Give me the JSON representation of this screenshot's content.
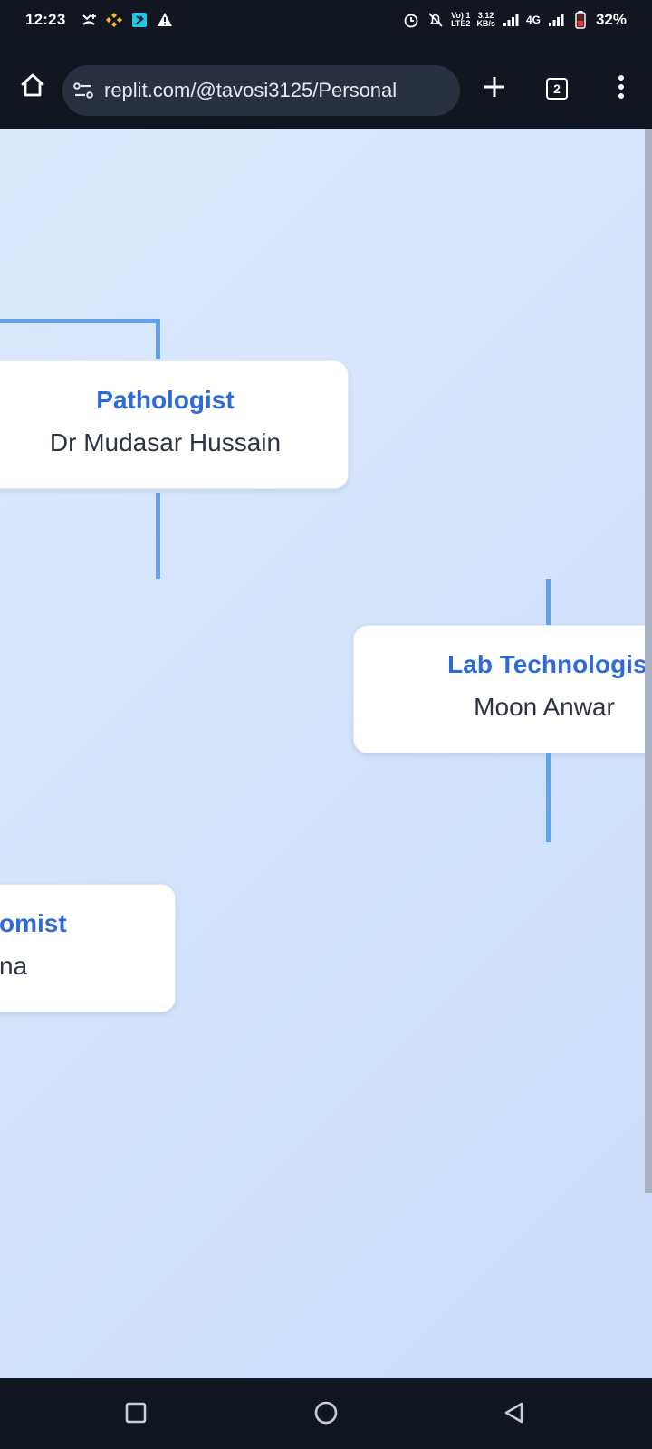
{
  "status_bar": {
    "time": "12:23",
    "network_line1": "Vo) 1",
    "network_line2": "LTE2",
    "speed_line1": "3.12",
    "speed_line2": "KB/s",
    "network_type": "4G",
    "battery": "32%"
  },
  "browser": {
    "url": "replit.com/@tavosi3125/Personal",
    "tab_count": "2"
  },
  "org_chart": {
    "pathologist": {
      "role": "Pathologist",
      "name": "Dr Mudasar Hussain"
    },
    "lab_technologist": {
      "role": "Lab Technologist",
      "name": "Moon Anwar"
    },
    "partial_card": {
      "role": "omist",
      "name": "na"
    }
  },
  "colors": {
    "accent": "#2f6bd6",
    "connector": "#61a1ee",
    "system_bar": "#111621"
  }
}
